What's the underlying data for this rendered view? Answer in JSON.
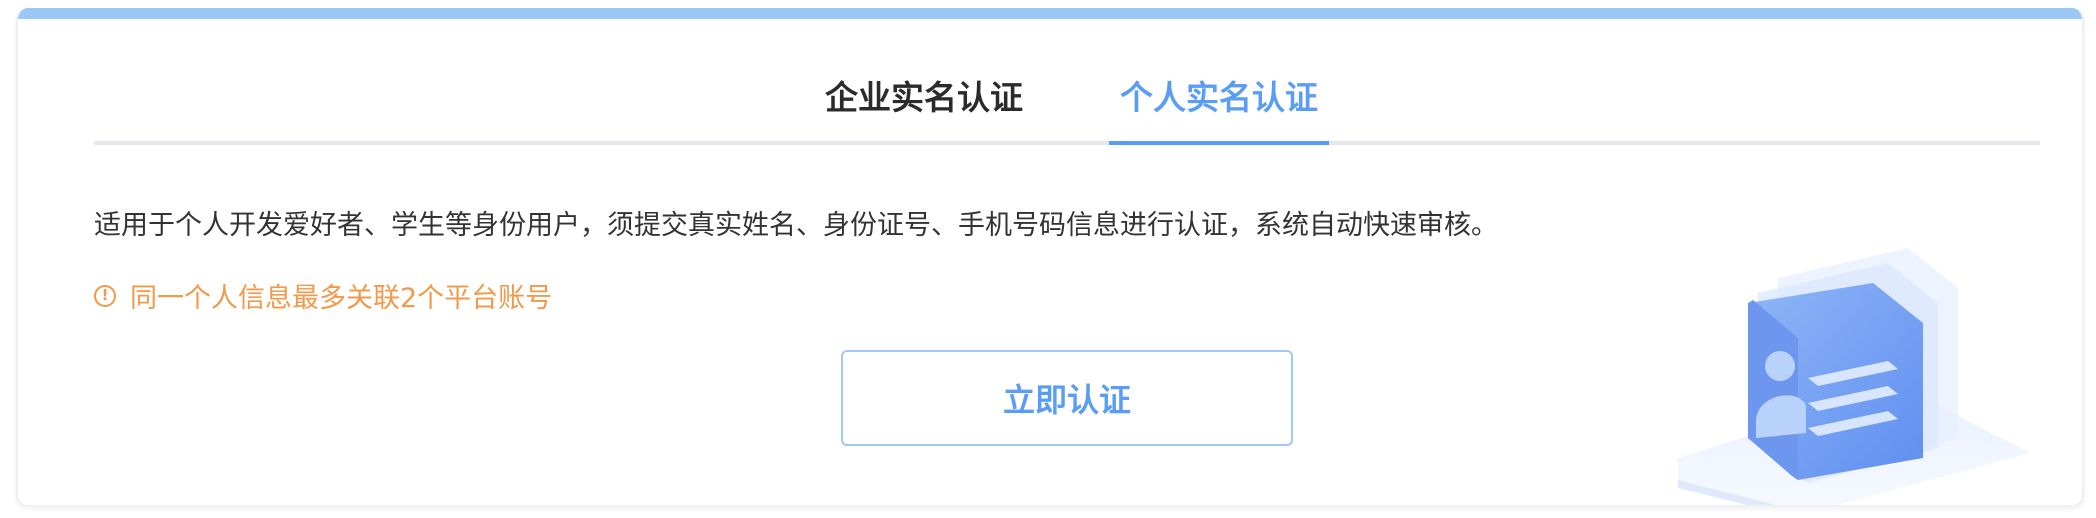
{
  "tabs": [
    {
      "label": "企业实名认证",
      "active": false
    },
    {
      "label": "个人实名认证",
      "active": true
    }
  ],
  "description": "适用于个人开发爱好者、学生等身份用户，须提交真实姓名、身份证号、手机号码信息进行认证，系统自动快速审核。",
  "warning": {
    "icon": "exclamation-circle-icon",
    "text": "同一个人信息最多关联2个平台账号"
  },
  "verify_button": {
    "label": "立即认证"
  },
  "illustration": {
    "icon": "id-card-icon"
  },
  "colors": {
    "accent": "#5a9df4",
    "warning": "#f2994a",
    "top_stripe": "#99c8f7",
    "text": "#333333"
  }
}
